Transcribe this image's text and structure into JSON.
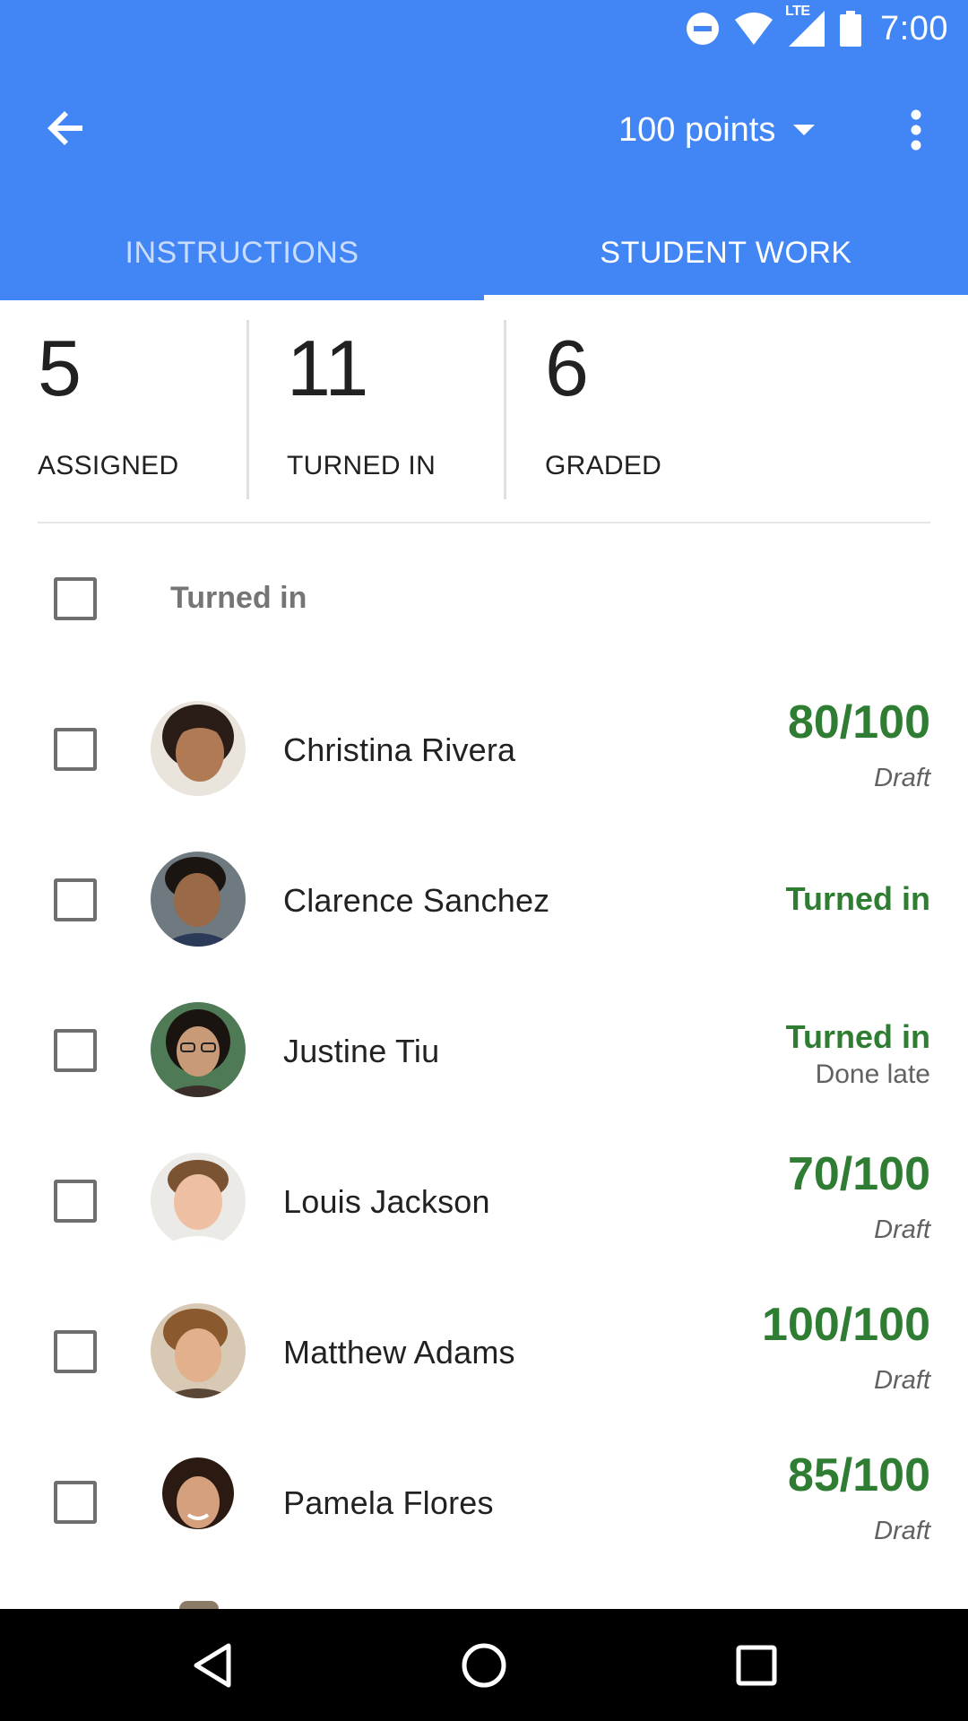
{
  "status_bar": {
    "time": "7:00",
    "network_label": "LTE",
    "icons": [
      "do-not-disturb-icon",
      "wifi-icon",
      "signal-icon",
      "battery-icon"
    ]
  },
  "toolbar": {
    "points_label": "100 points"
  },
  "tabs": [
    {
      "label": "INSTRUCTIONS",
      "active": false
    },
    {
      "label": "STUDENT WORK",
      "active": true
    }
  ],
  "stats": [
    {
      "number": "5",
      "label": "ASSIGNED"
    },
    {
      "number": "11",
      "label": "TURNED IN"
    },
    {
      "number": "6",
      "label": "GRADED"
    }
  ],
  "list": {
    "group_title": "Turned in",
    "students": [
      {
        "name": "Christina Rivera",
        "grade": "80/100",
        "sub": "Draft"
      },
      {
        "name": "Clarence Sanchez",
        "status": "Turned in"
      },
      {
        "name": "Justine Tiu",
        "status": "Turned in",
        "sub": "Done late"
      },
      {
        "name": "Louis Jackson",
        "grade": "70/100",
        "sub": "Draft"
      },
      {
        "name": "Matthew Adams",
        "grade": "100/100",
        "sub": "Draft"
      },
      {
        "name": "Pamela Flores",
        "grade": "85/100",
        "sub": "Draft"
      }
    ]
  },
  "colors": {
    "primary": "#4285f4",
    "grade_green": "#2e7d32",
    "nav_bar": "#000000"
  },
  "nav": [
    "back-triangle-icon",
    "home-circle-icon",
    "recents-square-icon"
  ]
}
